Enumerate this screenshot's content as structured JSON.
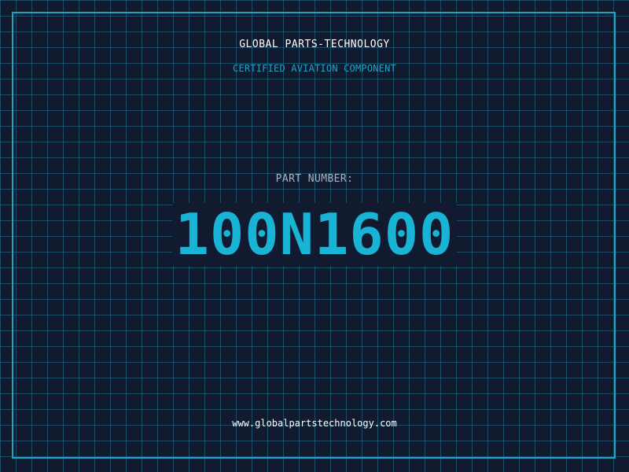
{
  "header": {
    "company": "GLOBAL PARTS-TECHNOLOGY",
    "subtitle": "CERTIFIED AVIATION COMPONENT"
  },
  "part": {
    "label": "PART NUMBER:",
    "number": "100N1600"
  },
  "footer": {
    "website": "www.globalpartstechnology.com"
  },
  "colors": {
    "background": "#111a2e",
    "grid": "#207896",
    "accent": "#19b3d6",
    "text": "#ffffff",
    "muted": "#aab4c4"
  }
}
